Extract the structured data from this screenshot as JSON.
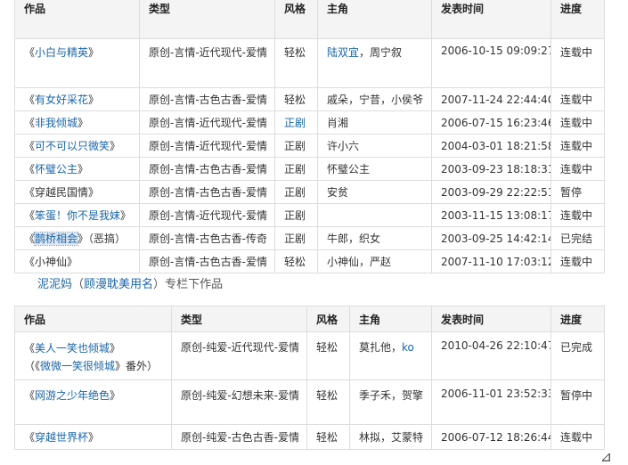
{
  "table1": {
    "headers": [
      "作品",
      "类型",
      "风格",
      "主角",
      "发表时间",
      "进度"
    ],
    "rows": [
      {
        "title": "小白与精英",
        "note": "",
        "genre": "原创-言情-近代现代-爱情",
        "style": "轻松",
        "style_link": false,
        "lead_link": "陆双宜",
        "lead": "，周宁叙",
        "date": "2006-10-15 09:09:27",
        "status": "连载中",
        "title_link": true
      },
      {
        "title": "有女好采花",
        "note": "",
        "genre": "原创-言情-古色古香-爱情",
        "style": "轻松",
        "style_link": false,
        "lead_link": "",
        "lead": "戚朵，宁昔，小侯爷",
        "date": "2007-11-24 22:44:40",
        "status": "连载中",
        "title_link": true
      },
      {
        "title": "非我倾城",
        "note": "",
        "genre": "原创-言情-近代现代-爱情",
        "style": "正剧",
        "style_link": true,
        "lead_link": "",
        "lead": "肖湘",
        "date": "2006-07-15 16:23:46",
        "status": "连载中",
        "title_link": true
      },
      {
        "title": "可不可以只微笑",
        "note": "",
        "genre": "原创-言情-近代现代-爱情",
        "style": "正剧",
        "style_link": false,
        "lead_link": "",
        "lead": "许小六",
        "date": "2004-03-01 18:21:58",
        "status": "连载中",
        "title_link": true
      },
      {
        "title": "怀璧公主",
        "note": "",
        "genre": "原创-言情-古色古香-爱情",
        "style": "正剧",
        "style_link": false,
        "lead_link": "",
        "lead": "怀璧公主",
        "date": "2003-09-23 18:18:31",
        "status": "连载中",
        "title_link": true
      },
      {
        "title": "穿越民国情",
        "note": "",
        "genre": "原创-言情-古色古香-爱情",
        "style": "正剧",
        "style_link": false,
        "lead_link": "",
        "lead": "安贫",
        "date": "2003-09-29 22:22:51",
        "status": "暂停",
        "title_link": false
      },
      {
        "title": "笨蛋！你不是我妹",
        "note": "",
        "genre": "原创-言情-近代现代-爱情",
        "style": "正剧",
        "style_link": false,
        "lead_link": "",
        "lead": "",
        "date": "2003-11-15 13:08:17",
        "status": "连载中",
        "title_link": true
      },
      {
        "title": "鹊桥相会",
        "note": "（恶搞）",
        "genre": "原创-言情-古色古香-传奇",
        "style": "正剧",
        "style_link": false,
        "lead_link": "",
        "lead": "牛郎，织女",
        "date": "2003-09-25 14:42:14",
        "status": "已完结",
        "title_link": true
      },
      {
        "title": "小神仙",
        "note": "",
        "genre": "原创-言情-古色古香-爱情",
        "style": "轻松",
        "style_link": false,
        "lead_link": "",
        "lead": "小神仙，严赵",
        "date": "2007-11-10 17:03:12",
        "status": "连载中",
        "title_link": false
      }
    ]
  },
  "section": {
    "name": "泥泥妈",
    "paren_open": "（",
    "alias": "顾漫耽美用名",
    "paren_close": "）",
    "suffix": "专栏下作品"
  },
  "table2": {
    "headers": [
      "作品",
      "类型",
      "风格",
      "主角",
      "发表时间",
      "进度"
    ],
    "rows": [
      {
        "title": "美人一笑也倾城",
        "extra_title": "微微一笑很倾城",
        "extra_suffix": "番外）",
        "genre": "原创-纯爱-近代现代-爱情",
        "style": "轻松",
        "lead": "莫扎他，",
        "lead_link": "ko",
        "date": "2010-04-26 22:10:47",
        "status": "已完成"
      },
      {
        "title": "网游之少年绝色",
        "extra_title": "",
        "extra_suffix": "",
        "genre": "原创-纯爱-幻想未来-爱情",
        "style": "轻松",
        "lead": "季子禾，贺擎",
        "lead_link": "",
        "date": "2006-11-01 23:52:33",
        "status": "暂停中"
      },
      {
        "title": "穿越世界杯",
        "extra_title": "",
        "extra_suffix": "",
        "genre": "原创-纯爱-古色古香-爱情",
        "style": "轻松",
        "lead": "林拟，艾蒙特",
        "lead_link": "",
        "date": "2006-07-12 18:26:44",
        "status": "连载中"
      }
    ]
  },
  "glyphs": {
    "quote_open": "《",
    "quote_close": "》",
    "extra_open": "（《"
  },
  "colors": {
    "link": "#1a66a8",
    "header_bg": "#f4f4f4",
    "border": "#dddddd"
  }
}
